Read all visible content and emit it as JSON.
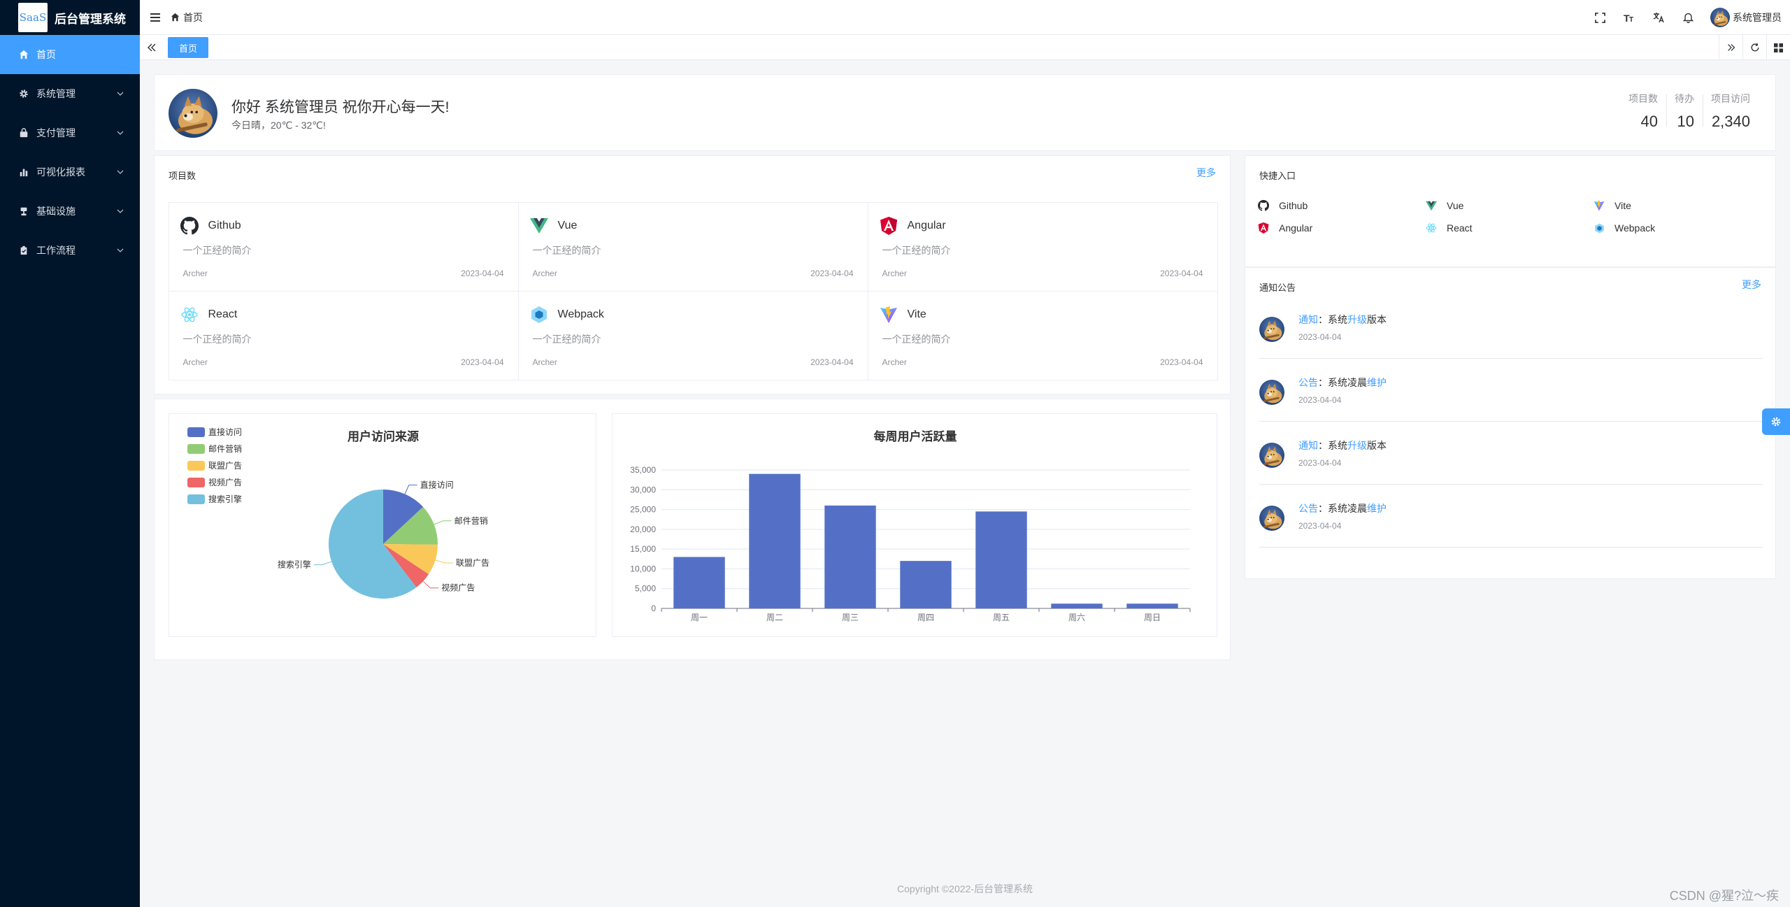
{
  "app": {
    "logo_text": "SaaS",
    "title": "后台管理系统"
  },
  "sidebar": {
    "items": [
      {
        "label": "首页",
        "icon": "home-icon",
        "active": true
      },
      {
        "label": "系统管理",
        "icon": "gear-icon"
      },
      {
        "label": "支付管理",
        "icon": "bag-icon"
      },
      {
        "label": "可视化报表",
        "icon": "chart-icon"
      },
      {
        "label": "基础设施",
        "icon": "stamp-icon"
      },
      {
        "label": "工作流程",
        "icon": "clipboard-icon"
      }
    ]
  },
  "header": {
    "breadcrumb": "首页",
    "user_name": "系统管理员"
  },
  "tabs": {
    "active": "首页"
  },
  "welcome": {
    "greeting": "你好 系统管理员 祝你开心每一天!",
    "weather": "今日晴，20℃ - 32℃!",
    "stats": [
      {
        "label": "项目数",
        "value": "40"
      },
      {
        "label": "待办",
        "value": "10"
      },
      {
        "label": "项目访问",
        "value": "2,340"
      }
    ]
  },
  "projects": {
    "title": "项目数",
    "more": "更多",
    "items": [
      {
        "name": "Github",
        "desc": "一个正经的简介",
        "author": "Archer",
        "date": "2023-04-04"
      },
      {
        "name": "Vue",
        "desc": "一个正经的简介",
        "author": "Archer",
        "date": "2023-04-04"
      },
      {
        "name": "Angular",
        "desc": "一个正经的简介",
        "author": "Archer",
        "date": "2023-04-04"
      },
      {
        "name": "React",
        "desc": "一个正经的简介",
        "author": "Archer",
        "date": "2023-04-04"
      },
      {
        "name": "Webpack",
        "desc": "一个正经的简介",
        "author": "Archer",
        "date": "2023-04-04"
      },
      {
        "name": "Vite",
        "desc": "一个正经的简介",
        "author": "Archer",
        "date": "2023-04-04"
      }
    ]
  },
  "quick": {
    "title": "快捷入口",
    "items": [
      "Github",
      "Vue",
      "Vite",
      "Angular",
      "React",
      "Webpack"
    ]
  },
  "notices": {
    "title": "通知公告",
    "more": "更多",
    "items": [
      {
        "tag": "通知",
        "sep": "：",
        "pre": "系统",
        "hl": "升级",
        "post": "版本",
        "date": "2023-04-04"
      },
      {
        "tag": "公告",
        "sep": "：",
        "pre": "系统凌晨",
        "hl": "维护",
        "post": "",
        "date": "2023-04-04"
      },
      {
        "tag": "通知",
        "sep": "：",
        "pre": "系统",
        "hl": "升级",
        "post": "版本",
        "date": "2023-04-04"
      },
      {
        "tag": "公告",
        "sep": "：",
        "pre": "系统凌晨",
        "hl": "维护",
        "post": "",
        "date": "2023-04-04"
      }
    ]
  },
  "chart_data": [
    {
      "type": "pie",
      "title": "用户访问来源",
      "legend_position": "top-left",
      "slices": [
        {
          "name": "直接访问",
          "value": 335,
          "color": "#5470c6"
        },
        {
          "name": "邮件营销",
          "value": 310,
          "color": "#91cc75"
        },
        {
          "name": "联盟广告",
          "value": 234,
          "color": "#fac858"
        },
        {
          "name": "视频广告",
          "value": 135,
          "color": "#ee6666"
        },
        {
          "name": "搜索引擎",
          "value": 1548,
          "color": "#73c0de"
        }
      ]
    },
    {
      "type": "bar",
      "title": "每周用户活跃量",
      "categories": [
        "周一",
        "周二",
        "周三",
        "周四",
        "周五",
        "周六",
        "周日"
      ],
      "values": [
        13000,
        34000,
        26000,
        12000,
        24500,
        1200,
        1200
      ],
      "ylim": [
        0,
        35000
      ],
      "yticks": [
        "0",
        "5,000",
        "10,000",
        "15,000",
        "20,000",
        "25,000",
        "30,000",
        "35,000"
      ],
      "grid": true,
      "color": "#5470c6"
    }
  ],
  "footer": {
    "copyright": "Copyright ©2022-后台管理系统"
  },
  "watermark": "CSDN @猩?泣～疾"
}
